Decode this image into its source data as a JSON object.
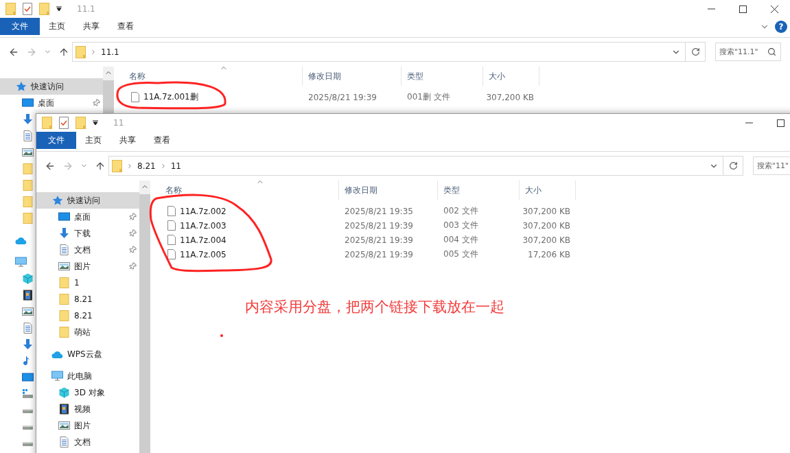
{
  "back_window": {
    "title": "11.1",
    "ribbon_tabs": [
      {
        "label": "文件",
        "kind": "file_menu"
      },
      {
        "label": "主页",
        "kind": "tab"
      },
      {
        "label": "共享",
        "kind": "tab"
      },
      {
        "label": "查看",
        "kind": "tab"
      }
    ],
    "help": "?",
    "address": [
      "11.1"
    ],
    "search": {
      "placeholder": "搜索\"11.1\""
    },
    "nav": [
      {
        "kind": "quick",
        "label": "快速访问",
        "selected": true
      },
      {
        "kind": "desktop",
        "label": "桌面",
        "pinned": true,
        "selected": false
      },
      {
        "kind": "download",
        "selected": false
      },
      {
        "kind": "document",
        "selected": false
      },
      {
        "kind": "pictures",
        "selected": false
      },
      {
        "kind": "folder",
        "selected": false
      },
      {
        "kind": "folder",
        "selected": false
      },
      {
        "kind": "folder",
        "selected": false
      },
      {
        "kind": "folder",
        "selected": false
      },
      {
        "kind": "cloud",
        "selected": false
      },
      {
        "kind": "pc",
        "selected": false
      },
      {
        "kind": "cube",
        "selected": false
      },
      {
        "kind": "video",
        "selected": false
      },
      {
        "kind": "pictures",
        "selected": false
      },
      {
        "kind": "document",
        "selected": false
      },
      {
        "kind": "download",
        "selected": false
      },
      {
        "kind": "music",
        "selected": false
      },
      {
        "kind": "desktop",
        "selected": false
      },
      {
        "kind": "windrive",
        "selected": false
      },
      {
        "kind": "drive",
        "selected": false
      },
      {
        "kind": "drive",
        "selected": false
      },
      {
        "kind": "drive",
        "selected": false
      }
    ],
    "columns": [
      "名称",
      "修改日期",
      "类型",
      "大小"
    ],
    "files": [
      {
        "name": "11A.7z.001删",
        "modified": "2025/8/21 19:39",
        "type": "001删 文件",
        "size": "307,200 KB"
      }
    ]
  },
  "front_window": {
    "title": "11",
    "ribbon_tabs": [
      {
        "label": "文件",
        "kind": "file_menu"
      },
      {
        "label": "主页",
        "kind": "tab"
      },
      {
        "label": "共享",
        "kind": "tab"
      },
      {
        "label": "查看",
        "kind": "tab"
      }
    ],
    "address": [
      "8.21",
      "11"
    ],
    "search": {
      "placeholder": "搜索\"11\""
    },
    "nav": [
      {
        "kind": "quick",
        "label": "快速访问",
        "selected": true
      },
      {
        "kind": "desktop",
        "label": "桌面",
        "pinned": true,
        "selected": false
      },
      {
        "kind": "download",
        "label": "下载",
        "pinned": true,
        "selected": false
      },
      {
        "kind": "document",
        "label": "文档",
        "pinned": true,
        "selected": false
      },
      {
        "kind": "pictures",
        "label": "图片",
        "pinned": true,
        "selected": false
      },
      {
        "kind": "folder",
        "label": "1",
        "pinned": false,
        "selected": false
      },
      {
        "kind": "folder",
        "label": "8.21",
        "pinned": false,
        "selected": false
      },
      {
        "kind": "folder",
        "label": "8.21",
        "pinned": false,
        "selected": false
      },
      {
        "kind": "folder",
        "label": "萌站",
        "pinned": false,
        "selected": false
      },
      {
        "kind": "cloud",
        "label": "WPS云盘",
        "selected": false
      },
      {
        "kind": "pc",
        "label": "此电脑",
        "selected": false
      },
      {
        "kind": "cube",
        "label": "3D 对象",
        "selected": false
      },
      {
        "kind": "video",
        "label": "视频",
        "selected": false
      },
      {
        "kind": "pictures",
        "label": "图片",
        "selected": false
      },
      {
        "kind": "document",
        "label": "文档",
        "selected": false
      }
    ],
    "columns": [
      "名称",
      "修改日期",
      "类型",
      "大小"
    ],
    "files": [
      {
        "name": "11A.7z.002",
        "modified": "2025/8/21 19:35",
        "type": "002 文件",
        "size": "307,200 KB"
      },
      {
        "name": "11A.7z.003",
        "modified": "2025/8/21 19:39",
        "type": "003 文件",
        "size": "307,200 KB"
      },
      {
        "name": "11A.7z.004",
        "modified": "2025/8/21 19:39",
        "type": "004 文件",
        "size": "307,200 KB"
      },
      {
        "name": "11A.7z.005",
        "modified": "2025/8/21 19:39",
        "type": "005 文件",
        "size": "17,206 KB"
      }
    ]
  },
  "annotation": {
    "text": "内容采用分盘，把两个链接下载放在一起"
  }
}
